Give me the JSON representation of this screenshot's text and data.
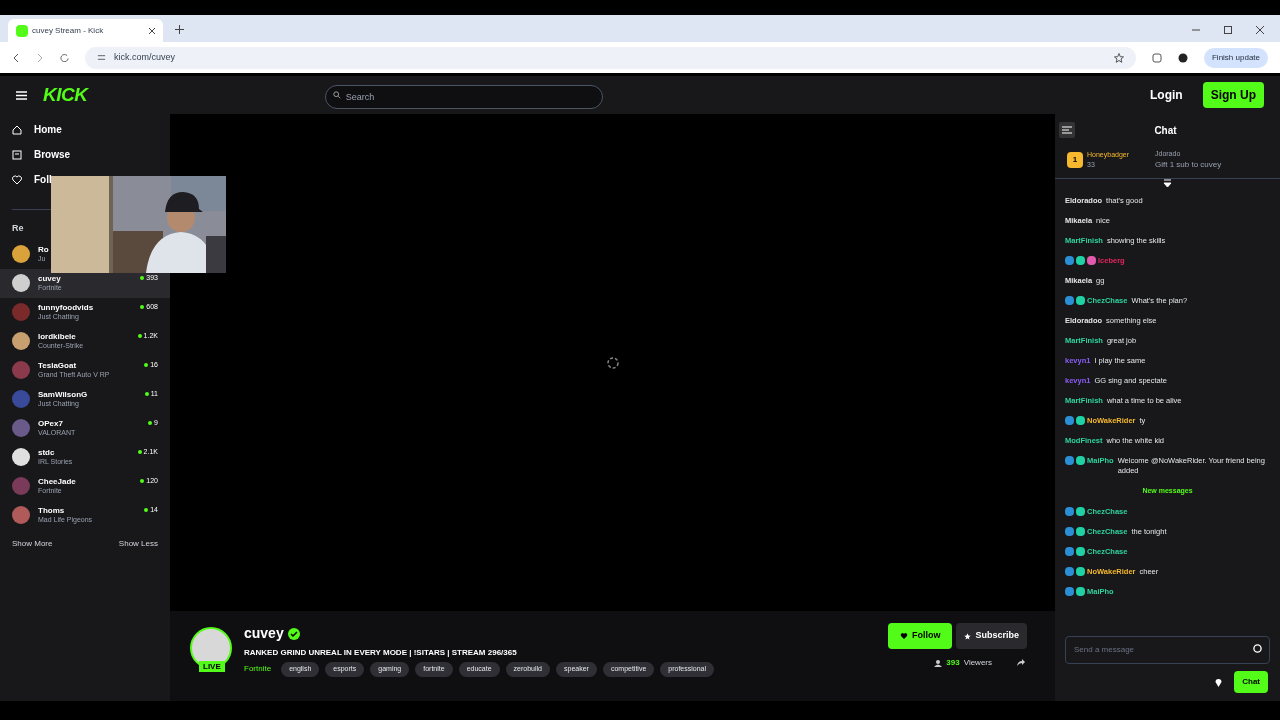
{
  "browser": {
    "tab_title": "cuvey Stream - Kick",
    "url": "kick.com/cuvey",
    "update_button": "Finish update"
  },
  "topbar": {
    "logo": "KICK",
    "search": {
      "placeholder": "Search"
    },
    "login": "Login",
    "signup": "Sign Up"
  },
  "sidebar": {
    "nav": [
      {
        "label": "Home"
      },
      {
        "label": "Browse"
      },
      {
        "label": "Foll"
      }
    ],
    "section": "Re",
    "channels": [
      {
        "name": "Ro",
        "category": "Ju",
        "selected": false,
        "color": "#d9a23a"
      },
      {
        "name": "cuvey",
        "category": "Fortnite",
        "viewers": "393",
        "selected": true,
        "color": "#cfcfcf"
      },
      {
        "name": "funnyfoodvids",
        "category": "Just Chatting",
        "viewers": "608",
        "selected": false,
        "color": "#7a2a2a"
      },
      {
        "name": "lordkibele",
        "category": "Counter-Strike",
        "viewers": "1.2K",
        "selected": false,
        "color": "#c8a070"
      },
      {
        "name": "TeslaGoat",
        "category": "Grand Theft Auto V RP",
        "viewers": "16",
        "selected": false,
        "color": "#8a3a4a"
      },
      {
        "name": "SamWilsonG",
        "category": "Just Chatting",
        "viewers": "11",
        "selected": false,
        "color": "#3a4a9a"
      },
      {
        "name": "OPex7",
        "category": "VALORANT",
        "viewers": "9",
        "selected": false,
        "color": "#6a5a8a"
      },
      {
        "name": "stdc",
        "category": "IRL Stories",
        "viewers": "2.1K",
        "selected": false,
        "color": "#e0e0e0"
      },
      {
        "name": "CheeJade",
        "category": "Fortnite",
        "viewers": "120",
        "selected": false,
        "color": "#7a3a5a"
      },
      {
        "name": "Thoms",
        "category": "Mad Life Pigeons",
        "viewers": "14",
        "selected": false,
        "color": "#b05a5a"
      }
    ],
    "show_more": "Show More",
    "show_less": "Show Less"
  },
  "stream": {
    "channel": "cuvey",
    "verified": true,
    "live_badge": "LIVE",
    "title": "RANKED GRIND UNREAL IN EVERY MODE | !SITARS | STREAM 296/365",
    "category": "Fortnite",
    "tags": [
      "english",
      "esports",
      "gaming",
      "fortnite",
      "educate",
      "zerobuild",
      "speaker",
      "competitive",
      "professional"
    ],
    "follow": "Follow",
    "subscribe": "Subscribe",
    "viewers": "393",
    "viewers_label": "Viewers"
  },
  "chat": {
    "title": "Chat",
    "pinned": {
      "rank": "1",
      "user": "Honeybadger",
      "count": "33",
      "item_1": "Jdorado",
      "item_2": "Gift 1 sub to cuvey"
    },
    "messages": [
      {
        "user": "Eldoradoo",
        "color": "#e5e5e5",
        "text": "that's good",
        "kind": "plain"
      },
      {
        "user": "Mikaela",
        "color": "#e5e5e5",
        "text": "nice",
        "kind": "plain"
      },
      {
        "user": "MartFinish",
        "color": "#2dd4a0",
        "text": "showing the skills",
        "kind": "plain"
      },
      {
        "user": "Iceberg",
        "color": "#e0245e",
        "kind": "vip"
      },
      {
        "user": "Mikaela",
        "color": "#e5e5e5",
        "text": "gg",
        "kind": "plain"
      },
      {
        "user": "ChezChase",
        "color": "#2dd4a0",
        "text": "What's the plan?",
        "kind": "sub"
      },
      {
        "user": "Eldoradoo",
        "color": "#e5e5e5",
        "text": "something else",
        "kind": "plain"
      },
      {
        "user": "MartFinish",
        "color": "#2dd4a0",
        "text": "great job",
        "kind": "plain"
      },
      {
        "user": "kevyn1",
        "color": "#8b5cf6",
        "text": "I play the same",
        "kind": "plain"
      },
      {
        "user": "kevyn1",
        "color": "#8b5cf6",
        "text": "GG sing and spectate",
        "kind": "plain"
      },
      {
        "user": "MartFinish",
        "color": "#2dd4a0",
        "text": "what a time to be alive",
        "kind": "plain"
      },
      {
        "user": "NoWakeRider",
        "color": "#f5b82e",
        "text": "ty",
        "kind": "sub"
      },
      {
        "user": "ModFinest",
        "color": "#2dd4a0",
        "text": "who the white kid",
        "kind": "plain"
      },
      {
        "user": "MaiPho",
        "color": "#2dd4a0",
        "text": "Welcome @NoWakeRider. Your friend being added",
        "kind": "sub"
      }
    ],
    "new_messages": "New messages",
    "messages_after": [
      {
        "user": "ChezChase",
        "color": "#2dd4a0",
        "kind": "sub"
      },
      {
        "user": "ChezChase",
        "color": "#2dd4a0",
        "text": "the tonight",
        "kind": "sub"
      },
      {
        "user": "ChezChase",
        "color": "#2dd4a0",
        "kind": "sub"
      },
      {
        "user": "NoWakeRider",
        "color": "#f5b82e",
        "text": "cheer",
        "kind": "sub"
      },
      {
        "user": "MaiPho",
        "color": "#2dd4a0",
        "kind": "sub"
      }
    ],
    "input": {
      "placeholder": "Send a message"
    },
    "send": "Chat"
  }
}
